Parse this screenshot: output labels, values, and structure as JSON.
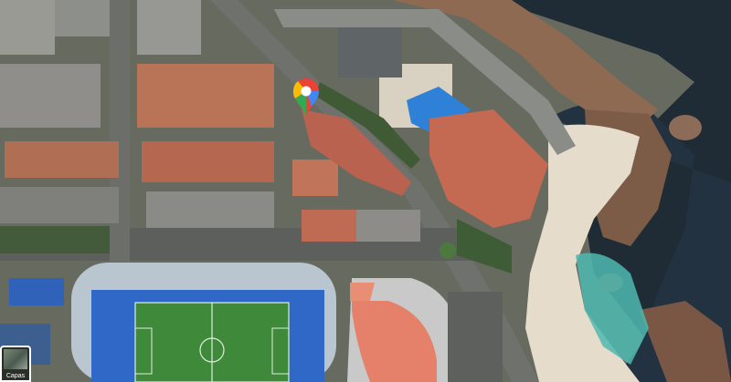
{
  "map": {
    "view": "satellite",
    "marker": {
      "icon": "google-maps-pin-icon",
      "colors": [
        "#ea4335",
        "#fbbc04",
        "#34a853",
        "#4285f4"
      ]
    },
    "layers_button": {
      "label": "Capas",
      "icon": "layers-thumbnail-icon"
    },
    "colors": {
      "sea": "#1e2b33",
      "beach": "#e8ddca",
      "pitch": "#3f8a3a",
      "stands": "#2f6fc9",
      "court": "#2f7fd8",
      "roof": "#c46a4f"
    }
  }
}
